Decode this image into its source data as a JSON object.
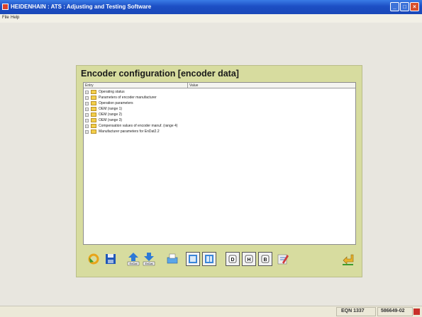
{
  "window": {
    "title": "HEIDENHAIN : ATS : Adjusting and Testing Software",
    "buttons": {
      "minimize": "_",
      "maximize": "□",
      "close": "×"
    }
  },
  "menu": {
    "items": [
      {
        "label": "File"
      },
      {
        "label": "Help"
      }
    ]
  },
  "dialog": {
    "title": "Encoder configuration [encoder data]",
    "columns": {
      "entry": "Entry",
      "value": "Value"
    },
    "tree": [
      {
        "label": "Operating status"
      },
      {
        "label": "Parameters of encoder manufacturer"
      },
      {
        "label": "Operation parameters"
      },
      {
        "label": "OEM (range 1)"
      },
      {
        "label": "OEM (range 2)"
      },
      {
        "label": "OEM (range 3)"
      },
      {
        "label": "Compensation values of encoder manuf. (range 4)"
      },
      {
        "label": "Manufacturer parameters for EnDat2.2"
      }
    ],
    "tree_expander": "+"
  },
  "toolbar": {
    "tools": [
      {
        "icon": "refresh-icon"
      },
      {
        "icon": "save-icon"
      },
      {
        "icon": "download-encoder-icon",
        "caption": "EnDat"
      },
      {
        "icon": "upload-encoder-icon",
        "caption": "EnDat"
      },
      {
        "icon": "print-icon"
      },
      {
        "icon": "tree-view-icon"
      },
      {
        "icon": "list-view-icon"
      },
      {
        "icon": "decimal-format-icon",
        "label": "D"
      },
      {
        "icon": "hex-format-icon",
        "label": "H"
      },
      {
        "icon": "binary-format-icon",
        "label": "B"
      },
      {
        "icon": "edit-values-icon"
      },
      {
        "icon": "back-icon"
      }
    ]
  },
  "status": {
    "encoder": "EQN 1337",
    "id": "586649-02"
  },
  "colors": {
    "titlebar": "#1c4fc4",
    "dialog_background": "#d7dc9f",
    "folder": "#f3cf4a"
  }
}
